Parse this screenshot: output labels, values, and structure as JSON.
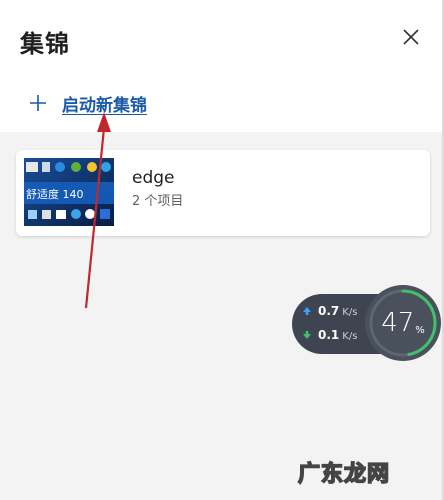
{
  "header": {
    "title": "集锦",
    "close_icon": "close-icon"
  },
  "actions": {
    "new_collection_label": "启动新集锦",
    "plus_icon": "plus-icon",
    "accent_color": "#1b5aa6"
  },
  "collections": [
    {
      "name": "edge",
      "item_count_text": "2 个项目",
      "thumbnail_text": "舒适度 140"
    }
  ],
  "network_widget": {
    "upload_value": "0.7",
    "upload_unit": "K/s",
    "download_value": "0.1",
    "download_unit": "K/s",
    "upload_color": "#3aa0ff",
    "download_color": "#3ec26a"
  },
  "usage_gauge": {
    "value": "47",
    "unit": "%",
    "fraction": 0.47
  },
  "watermark": {
    "text": "广东龙网"
  }
}
